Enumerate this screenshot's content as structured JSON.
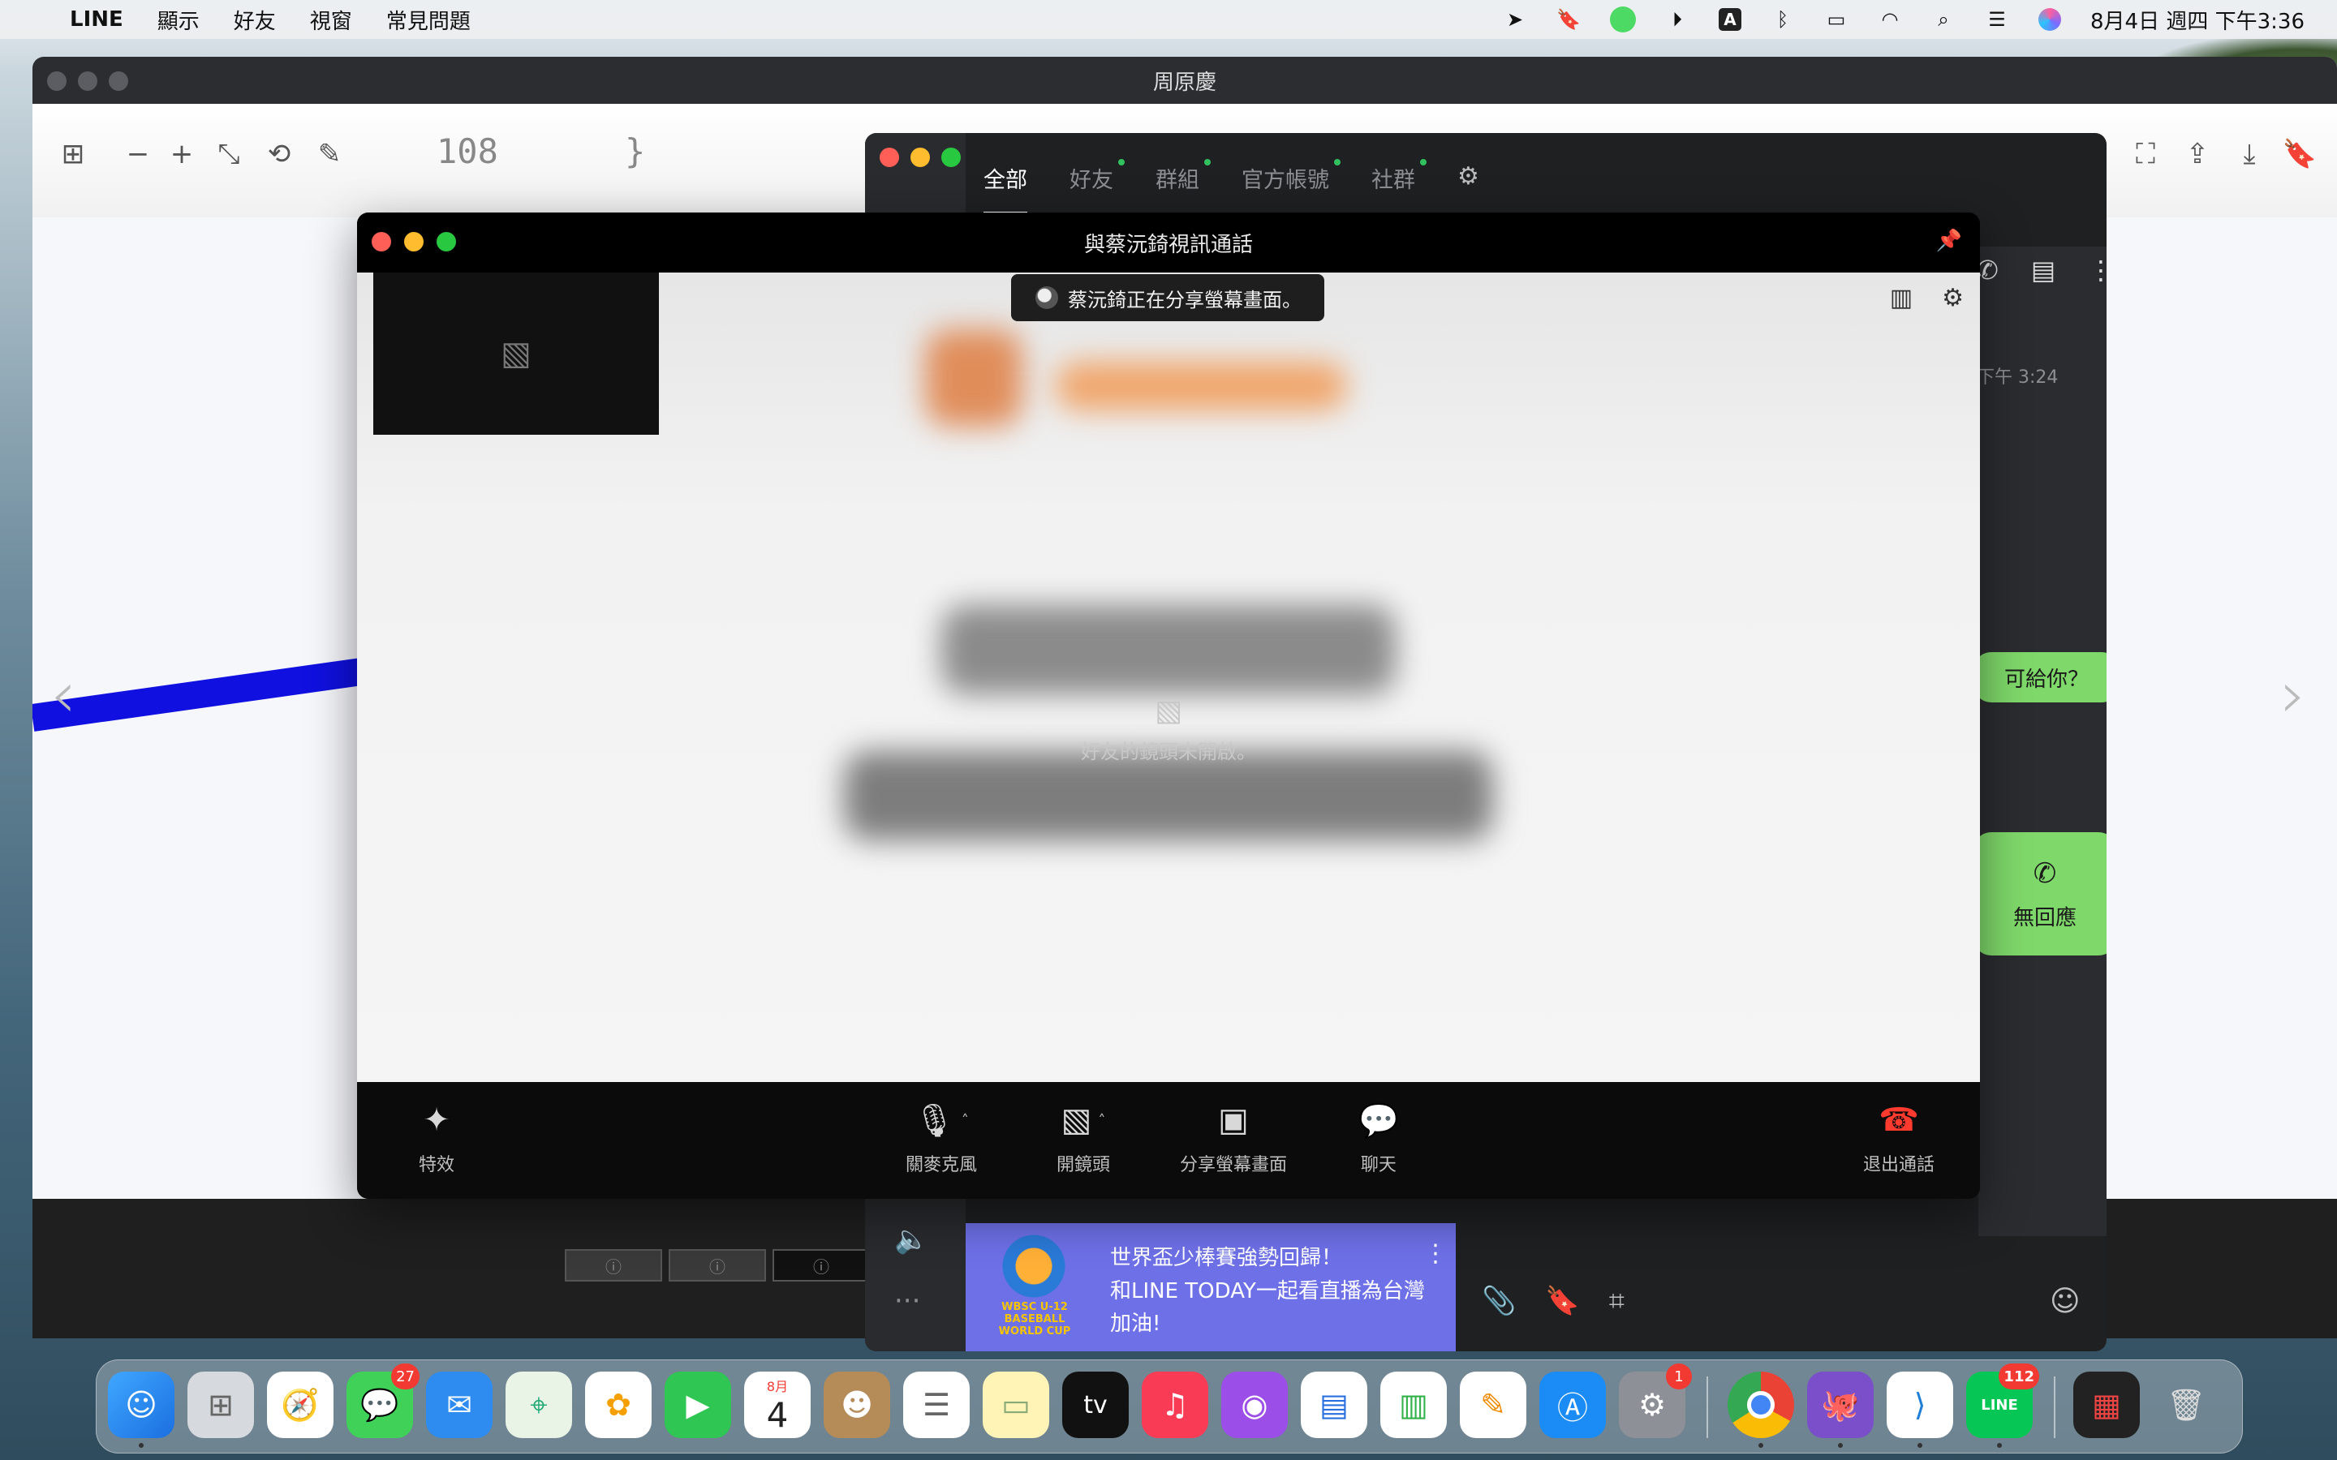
{
  "menubar": {
    "app_name": "LINE",
    "menus": [
      "顯示",
      "好友",
      "視窗",
      "常見問題"
    ],
    "clock": "8月4日 週四 下午3:36",
    "input_source": "A"
  },
  "viewer": {
    "title": "周原慶",
    "code_left": "108",
    "code_right": "}"
  },
  "line_window": {
    "tabs": [
      {
        "label": "全部",
        "active": true
      },
      {
        "label": "好友",
        "dot": true
      },
      {
        "label": "群組",
        "dot": true
      },
      {
        "label": "官方帳號",
        "dot": true
      },
      {
        "label": "社群",
        "dot": true
      }
    ],
    "chat_time": "下午 3:24",
    "bubble_text": "可給你？",
    "missed_call_text": "無回應",
    "ad": {
      "title": "世界盃少棒賽強勢回歸！",
      "body": "和LINE TODAY一起看直播為台灣加油!",
      "logo_text": "WBSC U-12 BASEBALL WORLD CUP"
    }
  },
  "call": {
    "title": "與蔡沅錡視訊通話",
    "share_banner": "蔡沅錡正在分享螢幕畫面。",
    "camera_off": "好友的鏡頭未開啟。",
    "controls": {
      "effects": "特效",
      "mic": "關麥克風",
      "camera": "開鏡頭",
      "share": "分享螢幕畫面",
      "chat": "聊天",
      "leave": "退出通話"
    }
  },
  "dock": {
    "messages_badge": "27",
    "calendar_month": "8月",
    "calendar_day": "4",
    "tv_label": "tv",
    "settings_badge": "1",
    "line_badge": "112",
    "line_label": "LINE"
  }
}
